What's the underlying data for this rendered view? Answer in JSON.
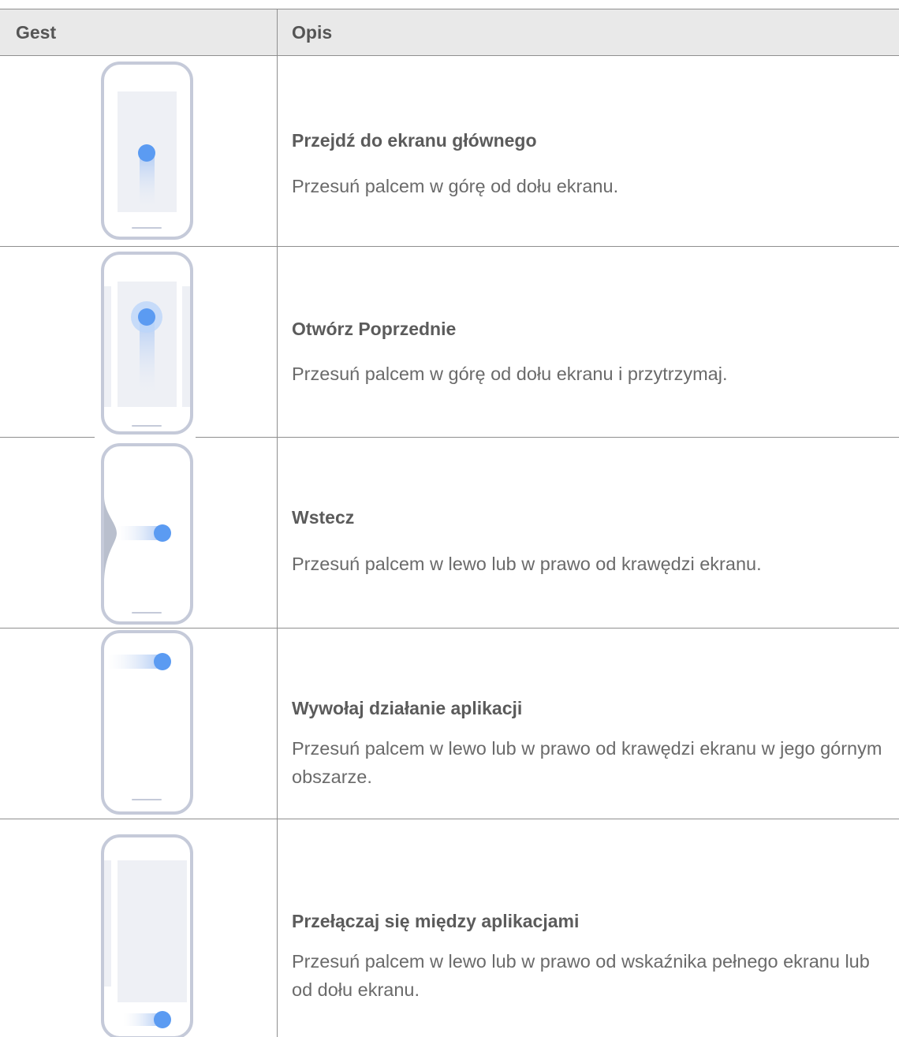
{
  "table": {
    "header": {
      "gesture": "Gest",
      "description": "Opis"
    },
    "rows": [
      {
        "gesture_icon": "swipe-up-home-illustration",
        "title": "Przejdź do ekranu głównego",
        "description": "Przesuń palcem w górę od dołu ekranu."
      },
      {
        "gesture_icon": "swipe-up-hold-recents-illustration",
        "title": "Otwórz Poprzednie",
        "description": "Przesuń palcem w górę od dołu ekranu i przytrzymaj."
      },
      {
        "gesture_icon": "swipe-edge-back-illustration",
        "title": "Wstecz",
        "description": "Przesuń palcem w lewo lub w prawo od krawędzi ekranu."
      },
      {
        "gesture_icon": "swipe-top-edge-app-action-illustration",
        "title": "Wywołaj działanie aplikacji",
        "description": "Przesuń palcem w lewo lub w prawo od krawędzi ekranu w jego górnym obszarze."
      },
      {
        "gesture_icon": "swipe-bottom-switch-apps-illustration",
        "title": "Przełączaj się między aplikacjami",
        "description": "Przesuń palcem w lewo lub w prawo od wskaźnika pełnego ekranu lub od dołu ekranu."
      }
    ]
  },
  "colors": {
    "header_bg": "#e9e9e9",
    "border": "#8f8f8f",
    "phone_outline": "#c5cad9",
    "screen_fill": "#eef0f5",
    "touch_dot": "#5b9bf2"
  }
}
